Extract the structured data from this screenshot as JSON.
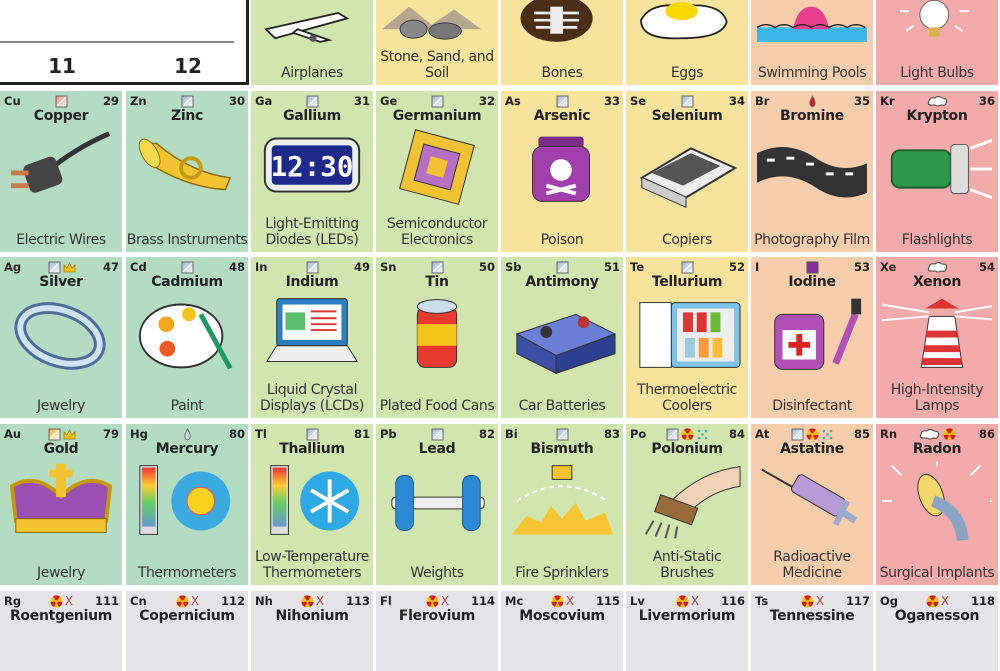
{
  "header": {
    "groups": [
      "11",
      "12"
    ]
  },
  "colors": {
    "transition": "#b4dcc3",
    "post_transition": "#d1e6ae",
    "nonmetal": "#f7e39b",
    "halogen": "#f7cdab",
    "noble_gas": "#f3aaaa",
    "synthetic": "#e4e4e7"
  },
  "top_row": [
    {
      "use": "Airplanes",
      "color": "post_transition",
      "img": "airplane-icon"
    },
    {
      "use": "Stone, Sand, and Soil",
      "color": "nonmetal",
      "img": "rocks-icon"
    },
    {
      "use": "Bones",
      "color": "nonmetal",
      "img": "skeleton-icon"
    },
    {
      "use": "Eggs",
      "color": "nonmetal",
      "img": "egg-icon"
    },
    {
      "use": "Swimming Pools",
      "color": "halogen",
      "img": "swimmer-icon"
    },
    {
      "use": "Light Bulbs",
      "color": "noble_gas",
      "img": "light-bulb-icon"
    }
  ],
  "rows": [
    [
      {
        "symbol": "Cu",
        "number": "29",
        "name": "Copper",
        "use": "Electric Wires",
        "color": "transition",
        "states": [
          "solid-copper"
        ],
        "img": "plug-icon"
      },
      {
        "symbol": "Zn",
        "number": "30",
        "name": "Zinc",
        "use": "Brass Instruments",
        "color": "transition",
        "states": [
          "solid"
        ],
        "img": "trumpet-icon"
      },
      {
        "symbol": "Ga",
        "number": "31",
        "name": "Gallium",
        "use": "Light-Emitting Diodes (LEDs)",
        "color": "post_transition",
        "states": [
          "solid"
        ],
        "img": "clock-icon",
        "clock": "12:30"
      },
      {
        "symbol": "Ge",
        "number": "32",
        "name": "Germanium",
        "use": "Semiconductor Electronics",
        "color": "post_transition",
        "states": [
          "solid"
        ],
        "img": "chip-icon"
      },
      {
        "symbol": "As",
        "number": "33",
        "name": "Arsenic",
        "use": "Poison",
        "color": "nonmetal",
        "states": [
          "solid"
        ],
        "img": "poison-icon"
      },
      {
        "symbol": "Se",
        "number": "34",
        "name": "Selenium",
        "use": "Copiers",
        "color": "nonmetal",
        "states": [
          "solid"
        ],
        "img": "copier-icon"
      },
      {
        "symbol": "Br",
        "number": "35",
        "name": "Bromine",
        "use": "Photography Film",
        "color": "halogen",
        "states": [
          "liquid-red"
        ],
        "img": "film-icon"
      },
      {
        "symbol": "Kr",
        "number": "36",
        "name": "Krypton",
        "use": "Flashlights",
        "color": "noble_gas",
        "states": [
          "gas"
        ],
        "img": "flashlight-icon"
      }
    ],
    [
      {
        "symbol": "Ag",
        "number": "47",
        "name": "Silver",
        "use": "Jewelry",
        "color": "transition",
        "states": [
          "solid",
          "precious"
        ],
        "img": "ring-icon"
      },
      {
        "symbol": "Cd",
        "number": "48",
        "name": "Cadmium",
        "use": "Paint",
        "color": "transition",
        "states": [
          "solid"
        ],
        "img": "palette-icon"
      },
      {
        "symbol": "In",
        "number": "49",
        "name": "Indium",
        "use": "Liquid Crystal Displays (LCDs)",
        "color": "post_transition",
        "states": [
          "solid"
        ],
        "img": "laptop-icon"
      },
      {
        "symbol": "Sn",
        "number": "50",
        "name": "Tin",
        "use": "Plated Food Cans",
        "color": "post_transition",
        "states": [
          "solid"
        ],
        "img": "can-icon"
      },
      {
        "symbol": "Sb",
        "number": "51",
        "name": "Antimony",
        "use": "Car Batteries",
        "color": "post_transition",
        "states": [
          "solid"
        ],
        "img": "battery-icon"
      },
      {
        "symbol": "Te",
        "number": "52",
        "name": "Tellurium",
        "use": "Thermoelectric Coolers",
        "color": "nonmetal",
        "states": [
          "solid"
        ],
        "img": "fridge-icon"
      },
      {
        "symbol": "I",
        "number": "53",
        "name": "Iodine",
        "use": "Disinfectant",
        "color": "halogen",
        "states": [
          "solid-purple"
        ],
        "img": "iodine-bottle-icon"
      },
      {
        "symbol": "Xe",
        "number": "54",
        "name": "Xenon",
        "use": "High-Intensity Lamps",
        "color": "noble_gas",
        "states": [
          "gas"
        ],
        "img": "lighthouse-icon"
      }
    ],
    [
      {
        "symbol": "Au",
        "number": "79",
        "name": "Gold",
        "use": "Jewelry",
        "color": "transition",
        "states": [
          "solid-gold",
          "precious"
        ],
        "img": "crown-icon"
      },
      {
        "symbol": "Hg",
        "number": "80",
        "name": "Mercury",
        "use": "Thermometers",
        "color": "transition",
        "states": [
          "liquid"
        ],
        "img": "thermometer-sun-icon"
      },
      {
        "symbol": "Tl",
        "number": "81",
        "name": "Thallium",
        "use": "Low-Temperature Thermometers",
        "color": "post_transition",
        "states": [
          "solid"
        ],
        "img": "thermometer-snow-icon"
      },
      {
        "symbol": "Pb",
        "number": "82",
        "name": "Lead",
        "use": "Weights",
        "color": "post_transition",
        "states": [
          "solid"
        ],
        "img": "dumbbell-icon"
      },
      {
        "symbol": "Bi",
        "number": "83",
        "name": "Bismuth",
        "use": "Fire Sprinklers",
        "color": "post_transition",
        "states": [
          "solid"
        ],
        "img": "sprinkler-icon"
      },
      {
        "symbol": "Po",
        "number": "84",
        "name": "Polonium",
        "use": "Anti-Static Brushes",
        "color": "post_transition",
        "states": [
          "solid",
          "radioactive",
          "dots"
        ],
        "img": "brush-icon"
      },
      {
        "symbol": "At",
        "number": "85",
        "name": "Astatine",
        "use": "Radioactive Medicine",
        "color": "halogen",
        "states": [
          "solid",
          "radioactive",
          "dots"
        ],
        "img": "syringe-icon"
      },
      {
        "symbol": "Rn",
        "number": "86",
        "name": "Radon",
        "use": "Surgical Implants",
        "color": "noble_gas",
        "states": [
          "gas",
          "radioactive"
        ],
        "img": "implant-icon"
      }
    ],
    [
      {
        "symbol": "Rg",
        "number": "111",
        "name": "Roentgenium",
        "color": "synthetic",
        "states": [
          "radioactive",
          "synthetic"
        ]
      },
      {
        "symbol": "Cn",
        "number": "112",
        "name": "Copernicium",
        "color": "synthetic",
        "states": [
          "radioactive",
          "synthetic"
        ]
      },
      {
        "symbol": "Nh",
        "number": "113",
        "name": "Nihonium",
        "color": "synthetic",
        "states": [
          "radioactive",
          "synthetic"
        ]
      },
      {
        "symbol": "Fl",
        "number": "114",
        "name": "Flerovium",
        "color": "synthetic",
        "states": [
          "radioactive",
          "synthetic"
        ]
      },
      {
        "symbol": "Mc",
        "number": "115",
        "name": "Moscovium",
        "color": "synthetic",
        "states": [
          "radioactive",
          "synthetic"
        ]
      },
      {
        "symbol": "Lv",
        "number": "116",
        "name": "Livermorium",
        "color": "synthetic",
        "states": [
          "radioactive",
          "synthetic"
        ]
      },
      {
        "symbol": "Ts",
        "number": "117",
        "name": "Tennessine",
        "color": "synthetic",
        "states": [
          "radioactive",
          "synthetic"
        ]
      },
      {
        "symbol": "Og",
        "number": "118",
        "name": "Oganesson",
        "color": "synthetic",
        "states": [
          "radioactive",
          "synthetic"
        ]
      }
    ]
  ]
}
